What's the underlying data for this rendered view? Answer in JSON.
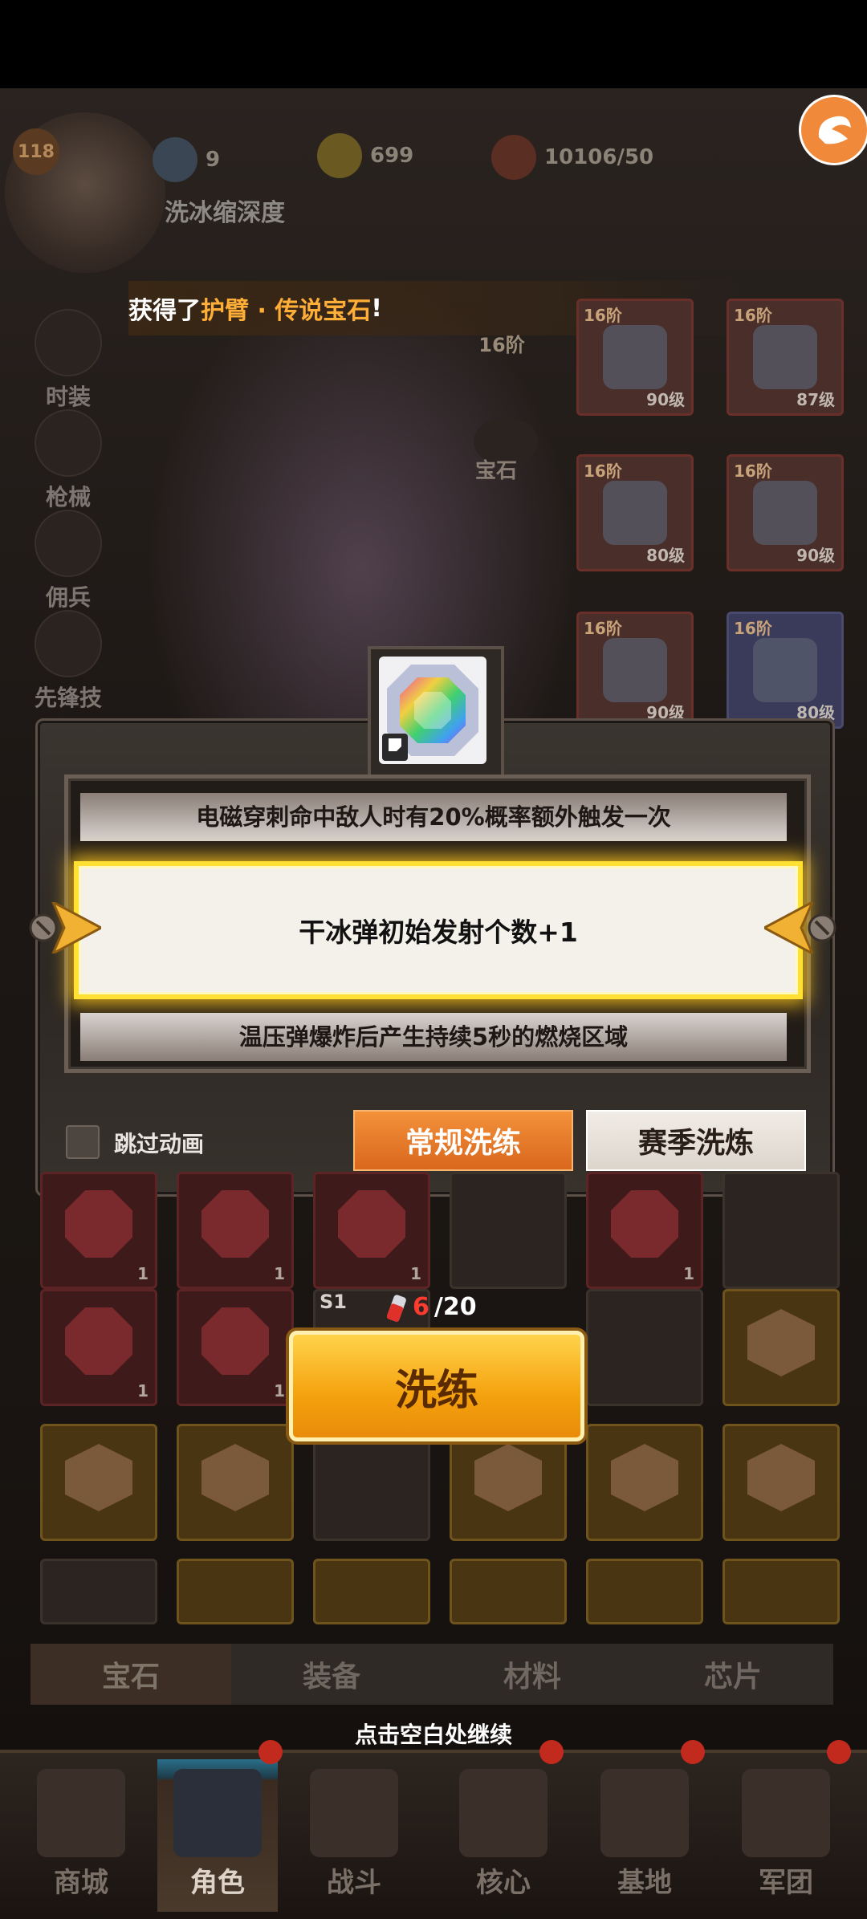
{
  "topbar": {
    "level": "118",
    "gem_count": "9",
    "coin_count": "699",
    "stamina": "10106/50",
    "char_label": "洗冰缩深度"
  },
  "reward_banner": {
    "prefix": "获得了",
    "item": "护臂 · 传说宝石",
    "suffix": "!"
  },
  "side_menu": [
    "时装",
    "枪械",
    "佣兵",
    "先锋技能"
  ],
  "gem_side_label": "宝石",
  "gem_side_tier": "16阶",
  "equipment": [
    {
      "tier": "16阶",
      "level": "90级"
    },
    {
      "tier": "16阶",
      "level": "87级"
    },
    {
      "tier": "16阶",
      "level": "80级"
    },
    {
      "tier": "16阶",
      "level": "90级"
    },
    {
      "tier": "16阶",
      "level": "90级"
    },
    {
      "tier": "16阶",
      "level": "80级"
    }
  ],
  "dialog": {
    "option_prev": "电磁穿刺命中敌人时有20%概率额外触发一次",
    "option_current": "干冰弹初始发射个数+1",
    "option_next": "温压弹爆炸后产生持续5秒的燃烧区域",
    "skip_animation": "跳过动画",
    "regular_refine": "常规洗练",
    "season_refine": "赛季洗炼"
  },
  "inventory_counts": [
    "1",
    "1",
    "1",
    "1",
    "1",
    "1"
  ],
  "refine": {
    "current": "6",
    "total": "/20",
    "button": "洗练",
    "tag": "S1"
  },
  "tabs": [
    {
      "label": "宝石",
      "active": true
    },
    {
      "label": "装备",
      "active": false
    },
    {
      "label": "材料",
      "active": false
    },
    {
      "label": "芯片",
      "active": false
    }
  ],
  "continue_hint": "点击空白处继续",
  "bottom_nav": [
    {
      "label": "商城"
    },
    {
      "label": "角色"
    },
    {
      "label": "战斗"
    },
    {
      "label": "核心"
    },
    {
      "label": "基地"
    },
    {
      "label": "军团"
    }
  ],
  "colors": {
    "accent_orange": "#e9852e",
    "highlight_yellow": "#ffe033",
    "counter_red": "#ff3b30"
  }
}
